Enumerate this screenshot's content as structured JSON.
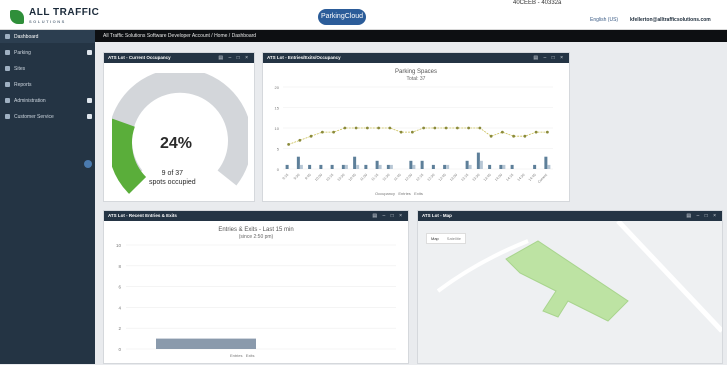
{
  "app": {
    "logo_text": "ALL TRAFFIC",
    "logo_sub": "SOLUTIONS",
    "product": "ParkingCloud",
    "language": "English (US)",
    "user_email": "kfellerton@alltrafficsolutions.com",
    "topright_text": "40CEEB - 40332a"
  },
  "breadcrumb": "All Traffic Solutions Software Developer Account / Home / Dashboard",
  "sidebar": {
    "items": [
      {
        "label": "Dashboard"
      },
      {
        "label": "Parking"
      },
      {
        "label": "Sites"
      },
      {
        "label": "Reports"
      },
      {
        "label": "Administration"
      },
      {
        "label": "Customer Service"
      }
    ]
  },
  "panels": {
    "occupancy": {
      "title": "ATS Lot - Current Occupancy",
      "percent": "24%",
      "spots_line1": "9 of 37",
      "spots_line2": "spots occupied",
      "fraction": 0.24
    },
    "entries_exits": {
      "title": "ATS Lot - Entries/Exits/Occupancy",
      "chart_title": "Parking Spaces",
      "chart_subtitle": "Total: 37",
      "legend": [
        "Occupancy",
        "Entries",
        "Exits"
      ]
    },
    "recent": {
      "title": "ATS Lot - Recent Entries & Exits",
      "chart_title": "Entries & Exits - Last 15 min",
      "chart_subtitle": "(since 2:50 pm)",
      "legend": [
        "Entries",
        "Exits"
      ]
    },
    "map": {
      "title": "ATS Lot - Map",
      "map_label": "Map",
      "sat_label": "Satellite"
    }
  },
  "chart_data": [
    {
      "type": "bar",
      "title": "Parking Spaces",
      "subtitle": "Total: 37",
      "categories": [
        "9:15",
        "9:30",
        "9:45",
        "10:00",
        "10:15",
        "10:30",
        "10:45",
        "11:00",
        "11:15",
        "11:30",
        "11:45",
        "12:00",
        "12:15",
        "12:30",
        "12:45",
        "13:00",
        "13:15",
        "13:30",
        "13:45",
        "14:00",
        "14:15",
        "14:30",
        "14:45",
        "Current"
      ],
      "ylim": [
        0,
        20
      ],
      "series": [
        {
          "name": "Occupancy",
          "type": "line",
          "values": [
            6,
            7,
            8,
            9,
            9,
            10,
            10,
            10,
            10,
            10,
            9,
            9,
            10,
            10,
            10,
            10,
            10,
            10,
            8,
            9,
            8,
            8,
            9,
            9
          ]
        },
        {
          "name": "Entries",
          "values": [
            1,
            3,
            1,
            1,
            1,
            1,
            3,
            1,
            2,
            1,
            0,
            2,
            2,
            1,
            1,
            0,
            2,
            4,
            1,
            1,
            1,
            0,
            1,
            3
          ]
        },
        {
          "name": "Exits",
          "values": [
            0,
            1,
            0,
            0,
            0,
            1,
            1,
            0,
            1,
            1,
            0,
            1,
            0,
            0,
            1,
            0,
            1,
            2,
            0,
            1,
            0,
            0,
            0,
            1
          ]
        }
      ]
    },
    {
      "type": "bar",
      "title": "Entries & Exits - Last 15 min",
      "subtitle": "(since 2:50 pm)",
      "ylim": [
        0,
        10
      ],
      "yticks": [
        0,
        2,
        4,
        6,
        8,
        10
      ],
      "series": [
        {
          "name": "Entries",
          "values": [
            1
          ]
        },
        {
          "name": "Exits",
          "values": [
            0
          ]
        }
      ]
    }
  ]
}
